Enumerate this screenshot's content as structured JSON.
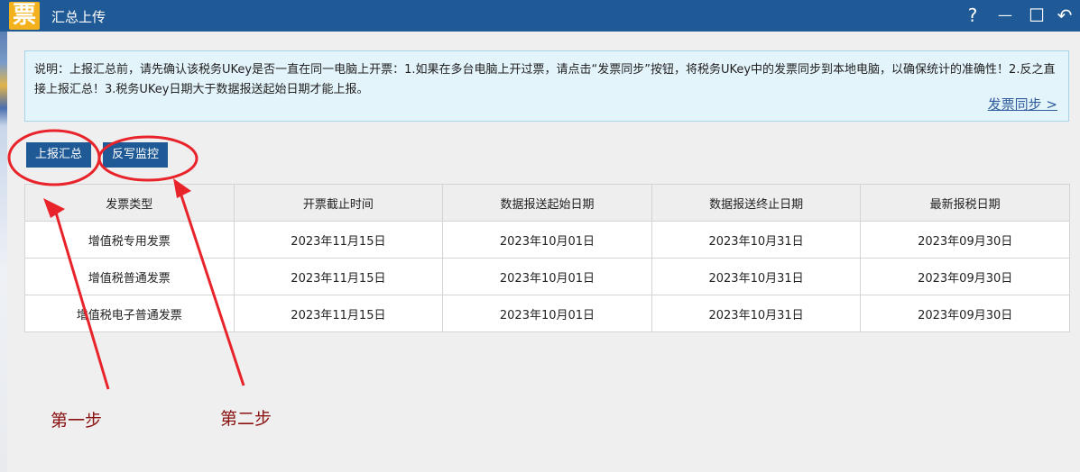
{
  "window": {
    "logo_char": "票",
    "title": "汇总上传",
    "help_label": "?",
    "minimize_label": "—",
    "maximize_label": "☐",
    "back_label": "↶"
  },
  "notice": {
    "text": "说明：上报汇总前，请先确认该税务UKey是否一直在同一电脑上开票：1.如果在多台电脑上开过票，请点击“发票同步”按钮，将税务UKey中的发票同步到本地电脑，以确保统计的准确性！2.反之直接上报汇总！3.税务UKey日期大于数据报送起始日期才能上报。",
    "sync_link": "发票同步 >"
  },
  "actions": {
    "report_summary": "上报汇总",
    "write_back_monitor": "反写监控"
  },
  "table": {
    "headers": [
      "发票类型",
      "开票截止时间",
      "数据报送起始日期",
      "数据报送终止日期",
      "最新报税日期"
    ],
    "rows": [
      [
        "增值税专用发票",
        "2023年11月15日",
        "2023年10月01日",
        "2023年10月31日",
        "2023年09月30日"
      ],
      [
        "增值税普通发票",
        "2023年11月15日",
        "2023年10月01日",
        "2023年10月31日",
        "2023年09月30日"
      ],
      [
        "增值税电子普通发票",
        "2023年11月15日",
        "2023年10月01日",
        "2023年10月31日",
        "2023年09月30日"
      ]
    ]
  },
  "annotations": {
    "step1": "第一步",
    "step2": "第二步",
    "color": "#e8232a"
  }
}
